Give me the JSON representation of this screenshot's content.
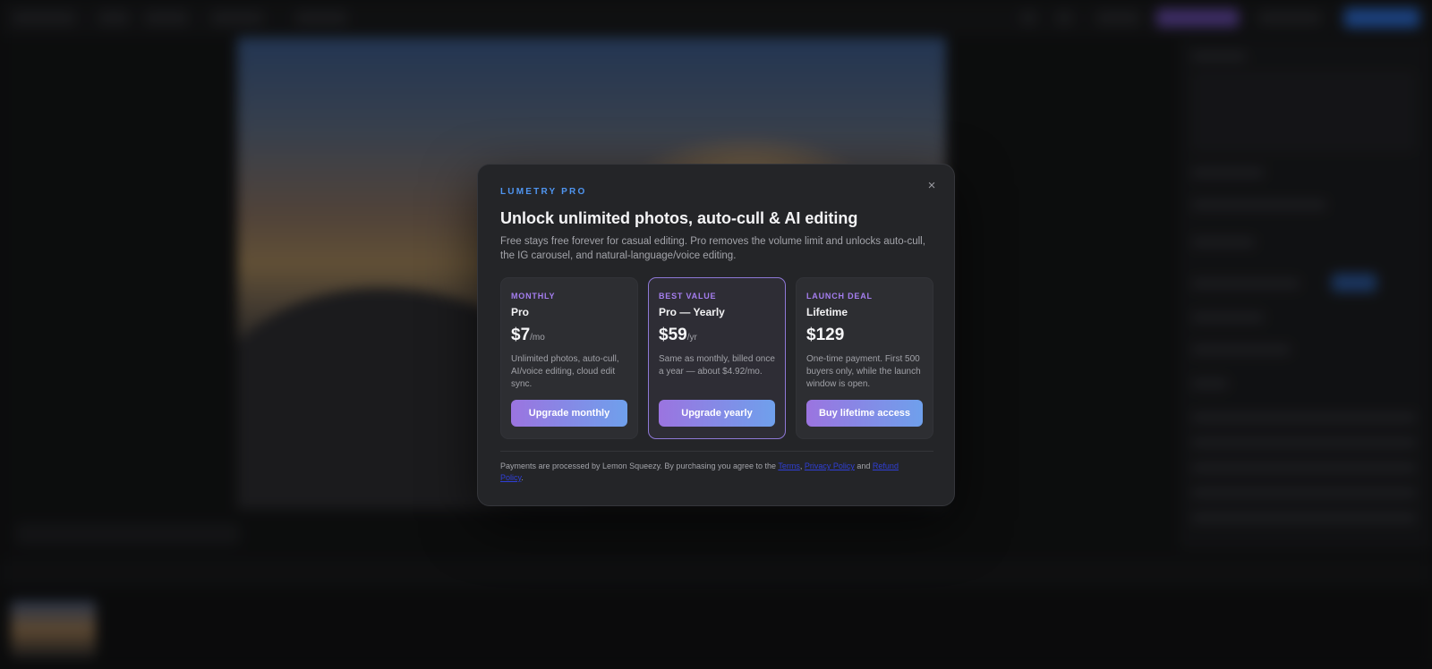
{
  "modal": {
    "close_icon": "×",
    "eyebrow": "LUMETRY PRO",
    "title": "Unlock unlimited photos, auto-cull & AI editing",
    "subtitle": "Free stays free forever for casual editing. Pro removes the volume limit and unlocks auto-cull, the IG carousel, and natural-language/voice editing.",
    "plans": [
      {
        "tag": "MONTHLY",
        "name": "Pro",
        "price": "$7",
        "unit": "/mo",
        "description": "Unlimited photos, auto-cull, AI/voice editing, cloud edit sync.",
        "button": "Upgrade monthly"
      },
      {
        "tag": "BEST VALUE",
        "name": "Pro — Yearly",
        "price": "$59",
        "unit": "/yr",
        "description": "Same as monthly, billed once a year — about $4.92/mo.",
        "button": "Upgrade yearly"
      },
      {
        "tag": "LAUNCH DEAL",
        "name": "Lifetime",
        "price": "$129",
        "unit": "",
        "description": "One-time payment. First 500 buyers only, while the launch window is open.",
        "button": "Buy lifetime access"
      }
    ],
    "footer": {
      "prefix": "Payments are processed by Lemon Squeezy. By purchasing you agree to the ",
      "link_terms": "Terms",
      "comma": ", ",
      "link_privacy": "Privacy Policy",
      "and": " and ",
      "link_refund": "Refund Policy",
      "suffix": "."
    }
  },
  "colors": {
    "accent_blue": "#4f95f0",
    "accent_purple": "#a57ef0",
    "modal_bg": "#242528",
    "button_gradient_start": "#9b74e0",
    "button_gradient_end": "#6fa0ec"
  }
}
